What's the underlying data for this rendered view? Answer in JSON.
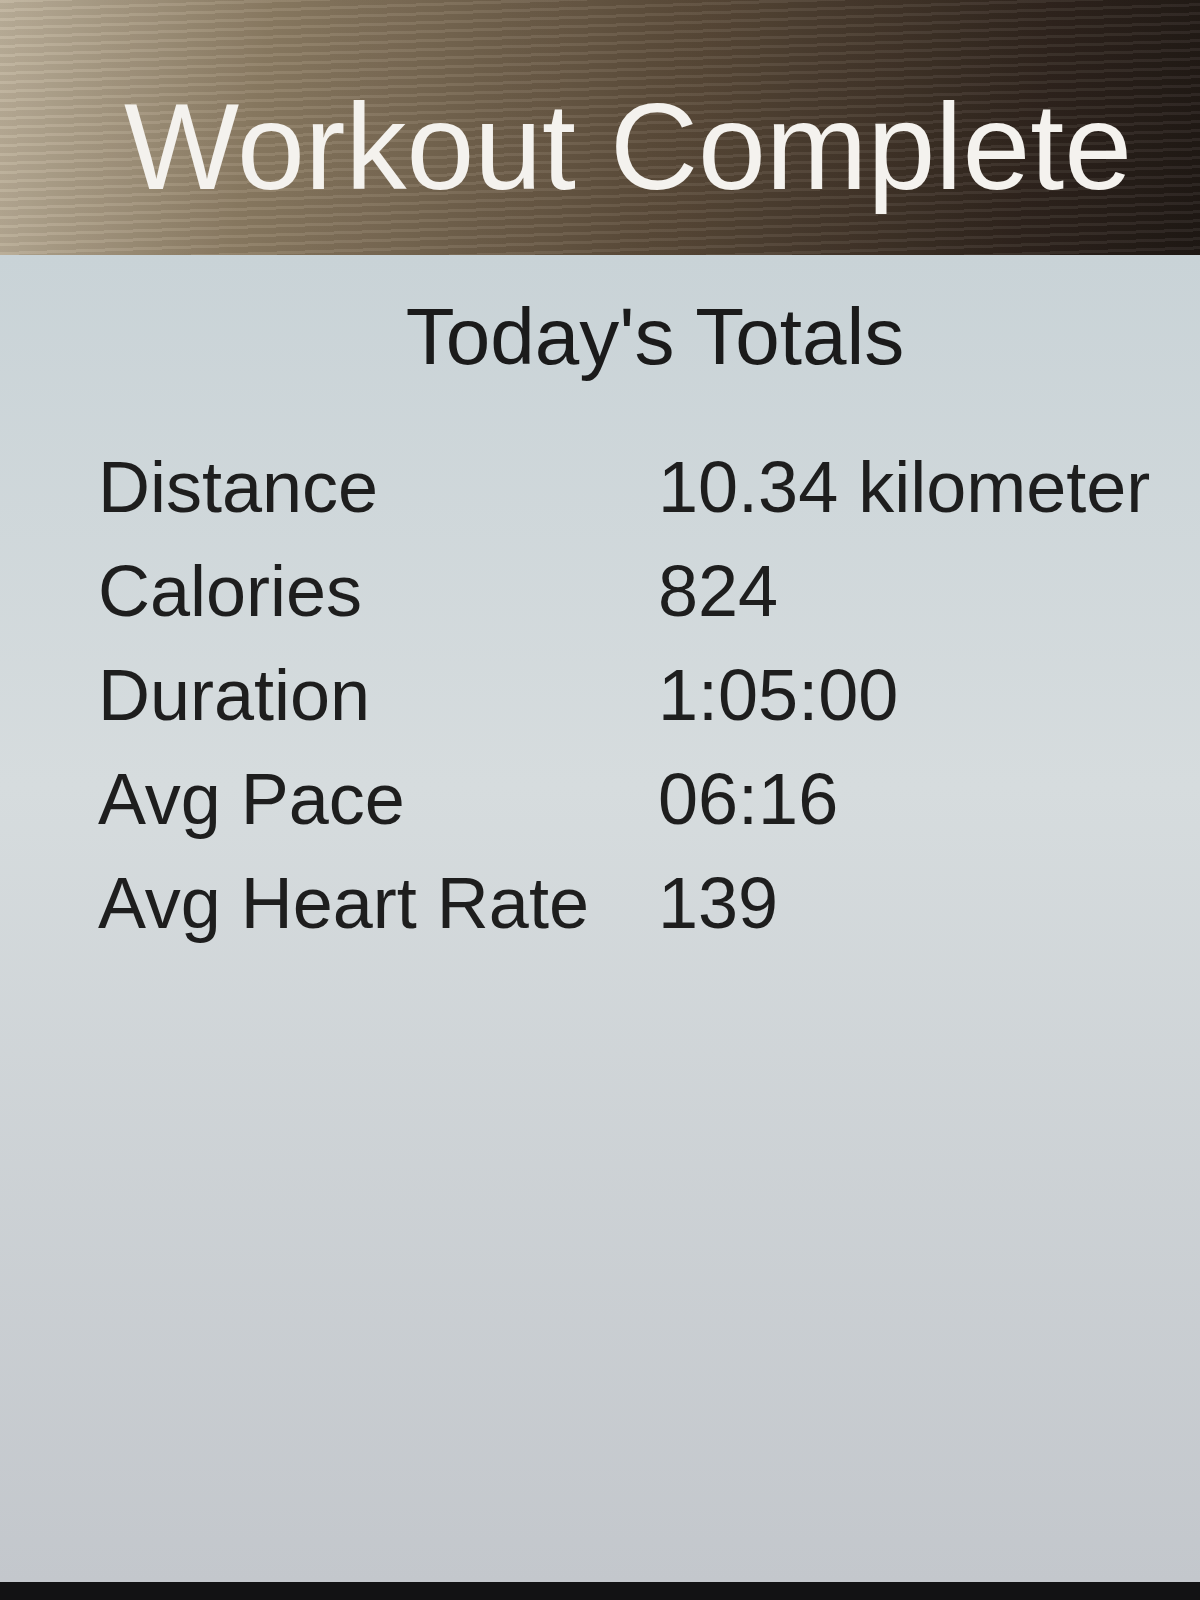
{
  "header": {
    "title": "Workout Complete"
  },
  "summary": {
    "title": "Today's Totals",
    "stats": [
      {
        "label": "Distance",
        "value": "10.34 kilometer"
      },
      {
        "label": "Calories",
        "value": "824"
      },
      {
        "label": "Duration",
        "value": "1:05:00"
      },
      {
        "label": "Avg Pace",
        "value": "06:16"
      },
      {
        "label": "Avg Heart Rate",
        "value": "139"
      }
    ]
  }
}
